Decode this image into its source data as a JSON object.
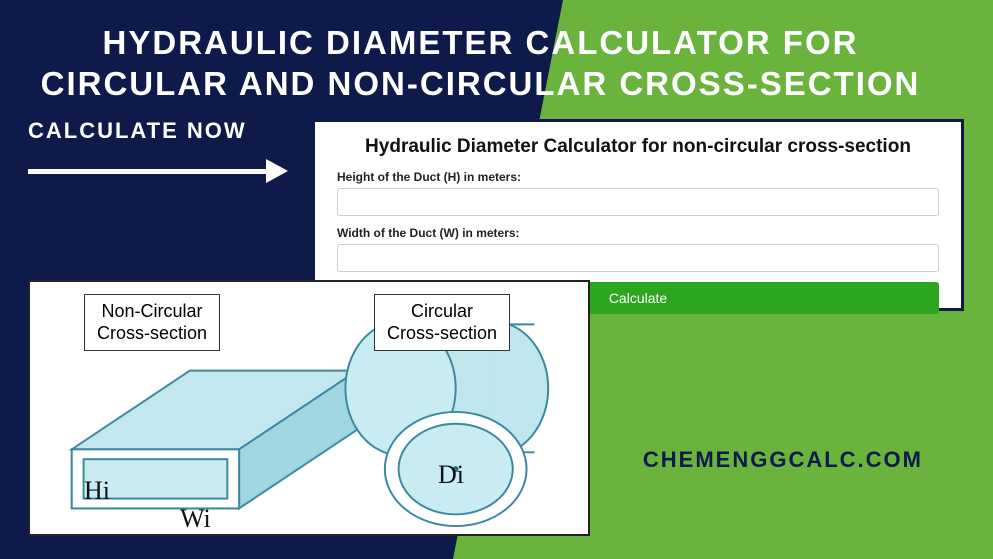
{
  "title": "HYDRAULIC DIAMETER CALCULATOR FOR CIRCULAR AND NON-CIRCULAR CROSS-SECTION",
  "cta": "CALCULATE NOW",
  "calculator": {
    "heading": "Hydraulic Diameter Calculator for non-circular cross-section",
    "height_label": "Height of the Duct (H) in meters:",
    "height_value": "",
    "width_label": "Width of the Duct (W) in meters:",
    "width_value": "",
    "button": "Calculate"
  },
  "diagram": {
    "non_circular_line1": "Non-Circular",
    "non_circular_line2": "Cross-section",
    "circular_line1": "Circular",
    "circular_line2": "Cross-section",
    "hi": "Hi",
    "wi": "Wi",
    "di": "Di"
  },
  "site": "CHEMENGGCALC.COM"
}
